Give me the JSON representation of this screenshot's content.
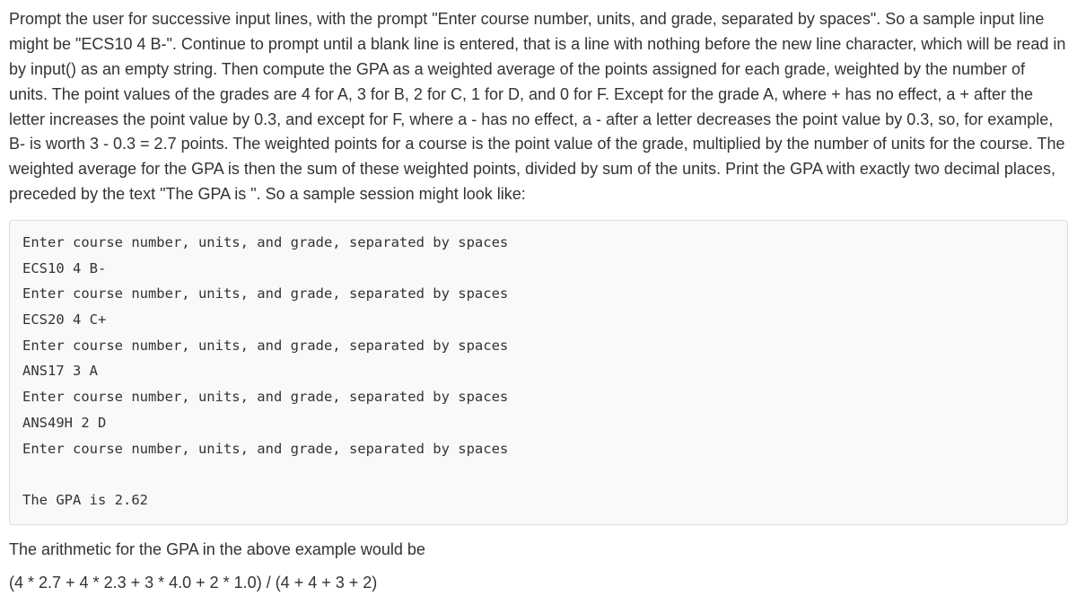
{
  "problem": {
    "paragraph": "Prompt the user for successive input lines, with the prompt \"Enter course number, units, and grade, separated by spaces\". So a sample input line might be \"ECS10 4 B-\". Continue to prompt until a blank line is entered, that is a line with nothing before the new line character, which will be read in by input() as an empty string. Then compute the GPA as a weighted average of the points assigned for each grade, weighted by the number of units. The point values of the grades are 4 for A, 3 for B, 2 for C, 1 for D, and 0 for F. Except for the grade A, where + has no effect, a + after the letter increases the point value by 0.3, and except for F, where a - has no effect, a - after a letter decreases the point value by 0.3, so, for example, B- is worth 3 - 0.3 = 2.7 points. The weighted points for a course is the point value of the grade, multiplied by the number of units for the course. The weighted average for the GPA is then the sum of these weighted points, divided by sum of the units. Print the GPA with exactly two decimal places, preceded by the text \"The GPA is \". So a sample session might look like:"
  },
  "session": {
    "lines": [
      "Enter course number, units, and grade, separated by spaces",
      "ECS10 4 B-",
      "Enter course number, units, and grade, separated by spaces",
      "ECS20 4 C+",
      "Enter course number, units, and grade, separated by spaces",
      "ANS17 3 A",
      "Enter course number, units, and grade, separated by spaces",
      "ANS49H 2 D",
      "Enter course number, units, and grade, separated by spaces",
      "",
      "The GPA is 2.62"
    ]
  },
  "explanation": {
    "text": "The arithmetic for the GPA in the above example would be",
    "formula": "(4 * 2.7 + 4 * 2.3 + 3 * 4.0 + 2 * 1.0) / (4 + 4 + 3 + 2)"
  }
}
